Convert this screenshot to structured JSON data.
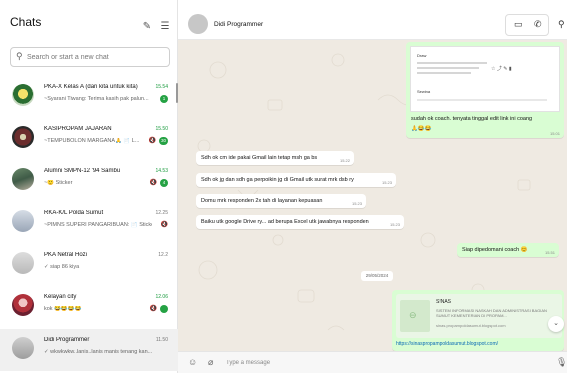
{
  "sidebar": {
    "title": "Chats",
    "search_placeholder": "Search or start a new chat",
    "chats": [
      {
        "name": "PKA-X Kelas A (dari kita untuk kita)",
        "time": "15.54",
        "preview": "~Syarani Tiwang: Terima kasih pak palun...",
        "badge": "1",
        "muted": false
      },
      {
        "name": "KASIPROPAM JAJARAN",
        "time": "15.50",
        "preview": "~TEMPUBOLON MARGANA🙏 📄 L...",
        "badge": "30",
        "muted": true
      },
      {
        "name": "Alumni SMPN-12 '94 Sambu",
        "time": "14.53",
        "preview": "~🙂 Sticker",
        "badge": "4",
        "muted": true
      },
      {
        "name": "RKA-K/L Polda Sumut",
        "time": "12.25",
        "preview": "~PIMNS SUPERI PANGARIBUAN: 📄 Sticker",
        "badge": "",
        "muted": true
      },
      {
        "name": "PKA Netral Hozi",
        "time": "12.2",
        "preview": "✓ siap 86 kiya",
        "badge": "",
        "muted": false
      },
      {
        "name": "Kelayan city",
        "time": "12.06",
        "preview": "kok 😂😂😂😂",
        "badge": "",
        "muted": true
      },
      {
        "name": "Didi Programmer",
        "time": "11.50",
        "preview": "✓ wkwkwkw..lanis..lanis manis tenang kan...",
        "badge": "",
        "muted": false
      }
    ]
  },
  "conversation": {
    "contact_name": "Didi Programmer",
    "date_chip": "29/05/2024",
    "input_placeholder": "Type a message",
    "screenshot_bubble": {
      "title_a": "Draw",
      "title_b": "Sewina",
      "caption": "sudah ok coach. tenyata tinggal edit link ini coang",
      "emoji": "🙏😂😂",
      "time": "15.01"
    },
    "incoming": [
      {
        "text": "Sdh ok cm ide pakai Gmail lain tetap msh ga bs",
        "time": "15.22"
      },
      {
        "text": "Sdh ok jg dan sdh ga perpoikin jg di Gmail utk surat mrk dsb ry",
        "time": "15.23"
      },
      {
        "text": "Domu mrk responden 2x tah di layanan kepuasan",
        "time": "15.23"
      },
      {
        "text": "Baiku utk google Drive ry... ad berupa Excel utk jawabnya responden",
        "time": "15.23"
      }
    ],
    "outgoing_reply": {
      "text": "Siap dipedomani coach 😊",
      "time": "15.51"
    },
    "link_preview": {
      "title": "S!NAS",
      "description": "SISTEM INFORMASI NASKAH DAN ADMINISTRASI BAGIAN SUMUT KEMENTERIAN DI PROPAM...",
      "url": "sinas.propampoldasumut.blogspot.com",
      "href": "https://sinaspropampoldasumut.blogspot.com/"
    }
  }
}
